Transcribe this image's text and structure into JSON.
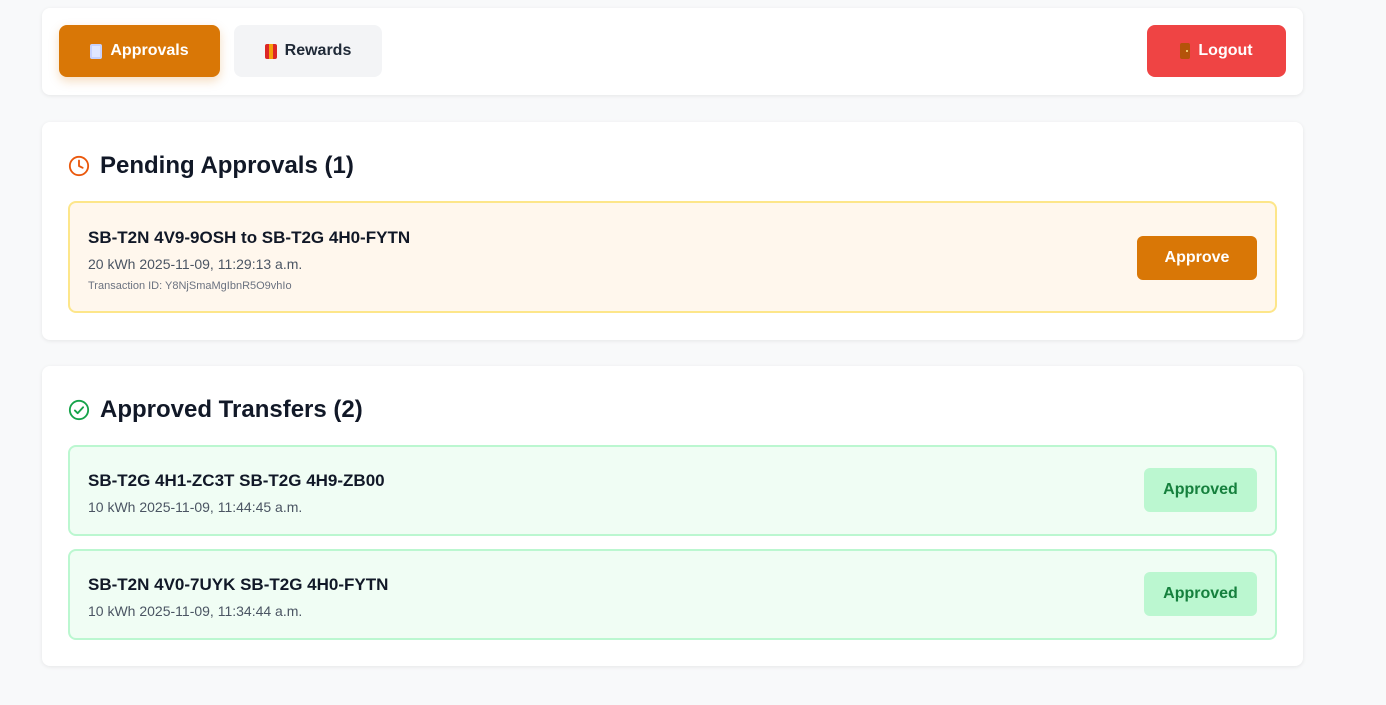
{
  "nav": {
    "approvals_label": "Approvals",
    "rewards_label": "Rewards",
    "logout_label": "Logout",
    "active_tab": "Approvals"
  },
  "pending": {
    "title": "Pending Approvals (1)",
    "icon": "clock-icon",
    "items": [
      {
        "title": "SB-T2N 4V9-9OSH to SB-T2G 4H0-FYTN",
        "detail": "20 kWh 2025-11-09, 11:29:13 a.m.",
        "transaction": "Transaction ID: Y8NjSmaMgIbnR5O9vhIo",
        "action_label": "Approve"
      }
    ]
  },
  "approved": {
    "title": "Approved Transfers (2)",
    "icon": "check-circle-icon",
    "items": [
      {
        "title": "SB-T2G 4H1-ZC3T SB-T2G 4H9-ZB00",
        "detail": "10 kWh 2025-11-09, 11:44:45 a.m.",
        "status": "Approved"
      },
      {
        "title": "SB-T2N 4V0-7UYK SB-T2G 4H0-FYTN",
        "detail": "10 kWh 2025-11-09, 11:34:44 a.m.",
        "status": "Approved"
      }
    ]
  },
  "colors": {
    "accent": "#d97706",
    "danger": "#ef4444",
    "success": "#15803d",
    "pending_bg": "#fff7ed",
    "approved_bg": "#f0fdf4"
  }
}
